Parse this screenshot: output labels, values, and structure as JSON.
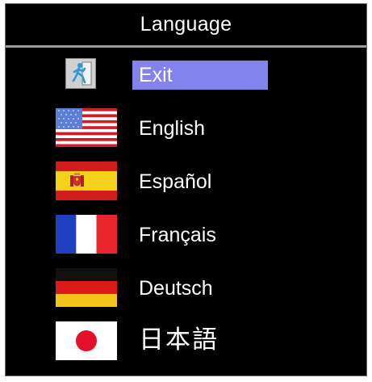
{
  "window": {
    "title": "Language"
  },
  "menu": {
    "items": [
      {
        "id": "exit",
        "label": "Exit",
        "icon": "exit-door-icon",
        "selected": true
      },
      {
        "id": "english",
        "label": "English",
        "icon": "us-flag-icon",
        "selected": false
      },
      {
        "id": "espanol",
        "label": "Español",
        "icon": "spain-flag-icon",
        "selected": false
      },
      {
        "id": "francais",
        "label": "Français",
        "icon": "france-flag-icon",
        "selected": false
      },
      {
        "id": "deutsch",
        "label": "Deutsch",
        "icon": "germany-flag-icon",
        "selected": false
      },
      {
        "id": "japanese",
        "label": "日本語",
        "icon": "japan-flag-icon",
        "selected": false
      }
    ]
  },
  "colors": {
    "background": "#000000",
    "selection": "#8383ee",
    "text": "#ffffff",
    "divider": "#9a9a9a"
  }
}
